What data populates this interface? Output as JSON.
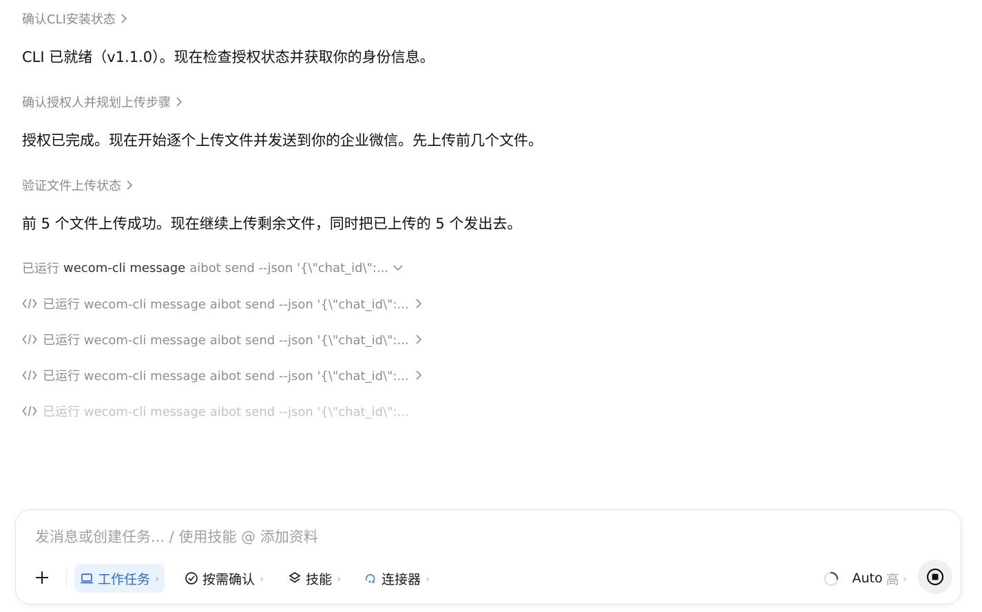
{
  "thread": {
    "step1_title": "确认CLI安装状态",
    "msg1": "CLI 已就绪（v1.1.0）。现在检查授权状态并获取你的身份信息。",
    "step2_title": "确认授权人并规划上传步骤",
    "msg2": "授权已完成。现在开始逐个上传文件并发送到你的企业微信。先上传前几个文件。",
    "step3_title": "验证文件上传状态",
    "msg3": "前 5 个文件上传成功。现在继续上传剩余文件，同时把已上传的 5 个发出去。",
    "run_group": {
      "prefix": "已运行",
      "command": "wecom-cli message",
      "args": "aibot send --json '{\\\"chat_id\\\":..."
    },
    "run_items": [
      {
        "text": "已运行 wecom-cli message aibot send --json '{\\\"chat_id\\\":..."
      },
      {
        "text": "已运行 wecom-cli message aibot send --json '{\\\"chat_id\\\":..."
      },
      {
        "text": "已运行 wecom-cli message aibot send --json '{\\\"chat_id\\\":..."
      },
      {
        "text": "已运行 wecom-cli message aibot send --json '{\\\"chat_id\\\":..."
      }
    ]
  },
  "composer": {
    "placeholder": "发消息或创建任务... / 使用技能 @ 添加资料",
    "chips": {
      "work_task": "工作任务",
      "confirm": "按需确认",
      "skills": "技能",
      "connectors": "连接器"
    },
    "model": {
      "name": "Auto",
      "level": "高"
    }
  },
  "colors": {
    "accent": "#2a6fd6",
    "accent_bg": "#eaf2fd",
    "muted_text": "#8a8a8a",
    "faded_text": "#c2c2c2"
  },
  "icons": [
    "chevron-right-icon",
    "chevron-down-icon",
    "code-icon",
    "plus-icon",
    "laptop-icon",
    "check-circle-icon",
    "layers-icon",
    "connector-icon",
    "spinner-icon",
    "stop-icon"
  ]
}
